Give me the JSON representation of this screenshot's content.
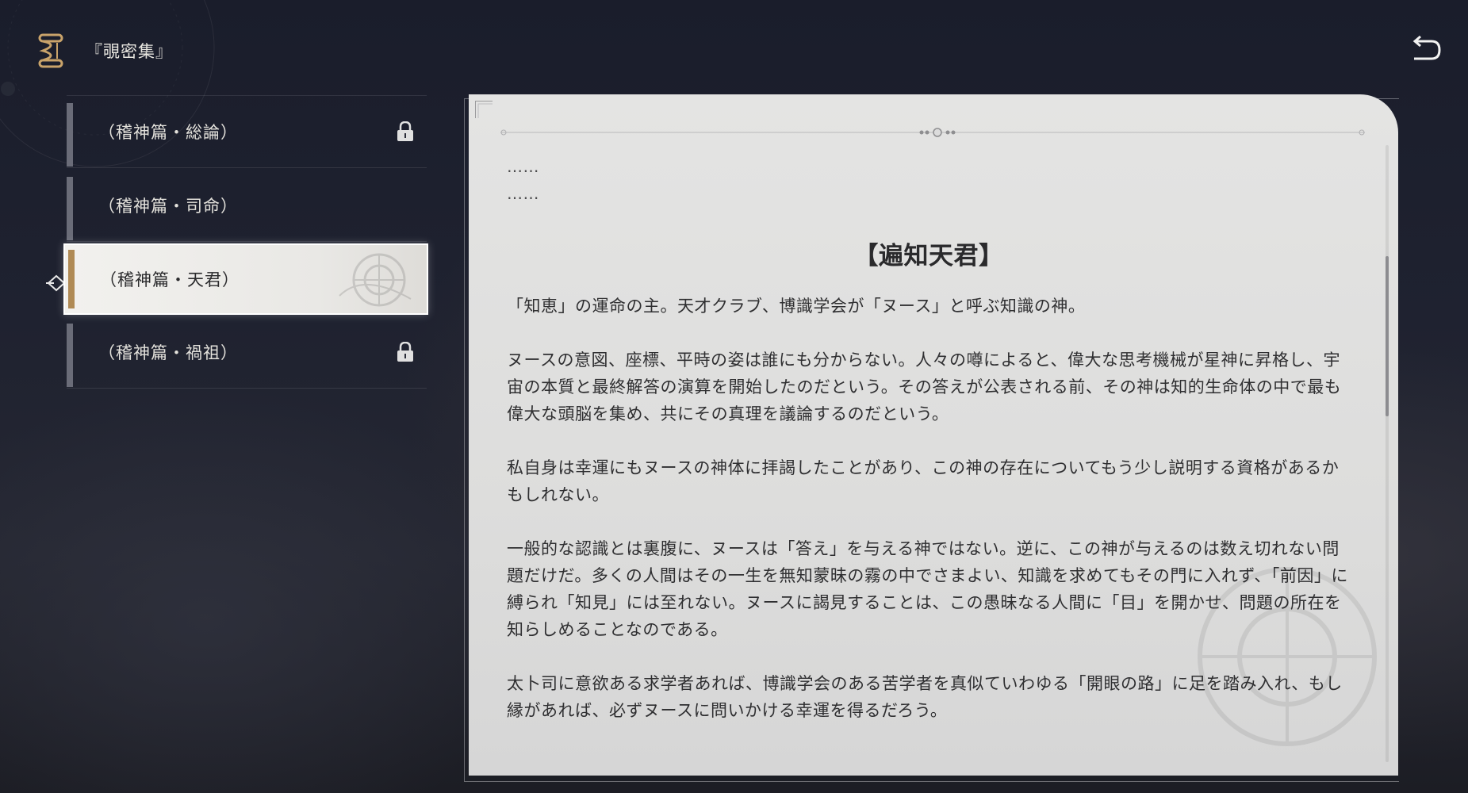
{
  "header": {
    "title": "『覗密集』",
    "icon": "book-scroll-icon",
    "back_icon": "return-arrow-icon"
  },
  "chapters": [
    {
      "label": "（稽神篇・総論）",
      "locked": true,
      "selected": false
    },
    {
      "label": "（稽神篇・司命）",
      "locked": false,
      "selected": false
    },
    {
      "label": "（稽神篇・天君）",
      "locked": false,
      "selected": true
    },
    {
      "label": "（稽神篇・禍祖）",
      "locked": true,
      "selected": false
    }
  ],
  "document": {
    "ellipsis_1": "……",
    "ellipsis_2": "……",
    "title": "【遍知天君】",
    "paragraphs": [
      "「知恵」の運命の主。天才クラブ、博識学会が「ヌース」と呼ぶ知識の神。",
      "ヌースの意図、座標、平時の姿は誰にも分からない。人々の噂によると、偉大な思考機械が星神に昇格し、宇宙の本質と最終解答の演算を開始したのだという。その答えが公表される前、その神は知的生命体の中で最も偉大な頭脳を集め、共にその真理を議論するのだという。",
      "私自身は幸運にもヌースの神体に拝謁したことがあり、この神の存在についてもう少し説明する資格があるかもしれない。",
      "一般的な認識とは裏腹に、ヌースは「答え」を与える神ではない。逆に、この神が与えるのは数え切れない問題だけだ。多くの人間はその一生を無知蒙昧の霧の中でさまよい、知識を求めてもその門に入れず、「前因」に縛られ「知見」には至れない。ヌースに謁見することは、この愚昧なる人間に「目」を開かせ、問題の所在を知らしめることなのである。",
      "太卜司に意欲ある求学者あれば、博識学会のある苦学者を真似ていわゆる「開眼の路」に足を踏み入れ、もし縁があれば、必ずヌースに問いかける幸運を得るだろう。"
    ]
  },
  "colors": {
    "accent_gold": "#b08a55",
    "panel_bg": "#e4e4e3",
    "text_dark": "#2f2f31"
  }
}
